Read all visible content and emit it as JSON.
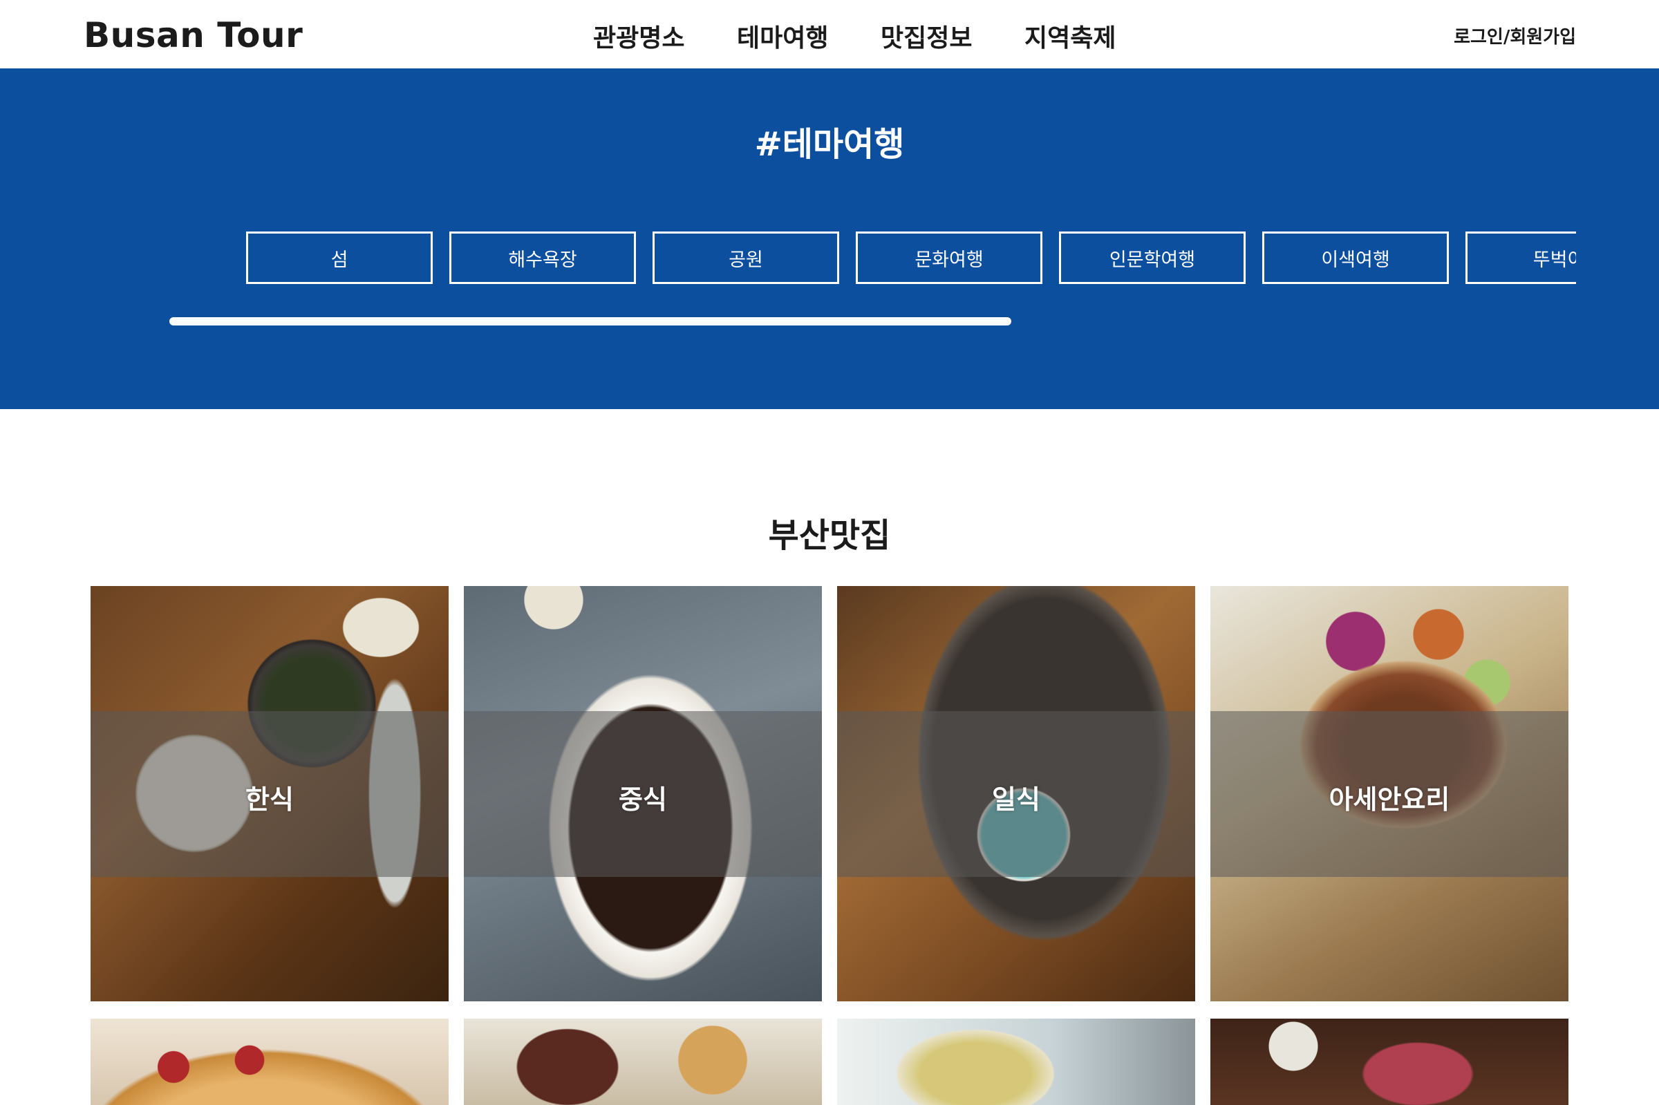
{
  "header": {
    "logo": "Busan Tour",
    "nav": [
      "관광명소",
      "테마여행",
      "맛집정보",
      "지역축제"
    ],
    "auth": "로그인/회원가입"
  },
  "theme": {
    "title": "#테마여행",
    "buttons": [
      "섬",
      "해수욕장",
      "공원",
      "문화여행",
      "인문학여행",
      "이색여행",
      "뚜벅이"
    ],
    "bg_color": "#0c4f9f",
    "scroll_progress_fraction": 0.45
  },
  "food": {
    "title": "부산맛집",
    "highlight_color": "#4a8ad4",
    "cards": [
      {
        "label": "한식",
        "image": "korean-food"
      },
      {
        "label": "중식",
        "image": "jjajangmyeon"
      },
      {
        "label": "일식",
        "image": "japanese-food"
      },
      {
        "label": "아세안요리",
        "image": "asian-food"
      },
      {
        "label": "",
        "image": "pizza"
      },
      {
        "label": "",
        "image": "dessert"
      },
      {
        "label": "",
        "image": "salad"
      },
      {
        "label": "",
        "image": "bbq"
      }
    ]
  }
}
